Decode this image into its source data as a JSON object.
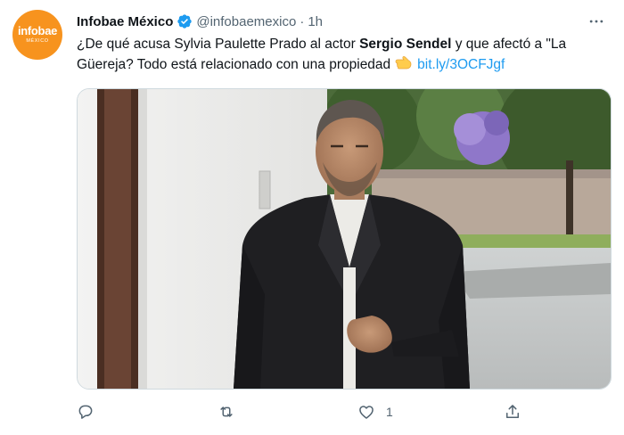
{
  "tweet": {
    "author": {
      "display_name": "Infobae México",
      "handle": "@infobaemexico",
      "avatar_brand": "infobae",
      "avatar_sub": "MÉXICO",
      "verified": true
    },
    "separator": "·",
    "time": "1h",
    "more_label": "•••",
    "text": {
      "part1": "¿De qué acusa Sylvia Paulette Prado al actor ",
      "bold1": "Sergio Sendel",
      "part2": " y que afectó a \"La Güereja? Todo está relacionado con una propiedad",
      "link": "bit.ly/3OCFJgf"
    },
    "media": {
      "description_icon": "photo"
    },
    "actions": {
      "reply": {
        "icon": "reply-icon",
        "count": ""
      },
      "retweet": {
        "icon": "retweet-icon",
        "count": ""
      },
      "like": {
        "icon": "like-icon",
        "count": "1"
      },
      "share": {
        "icon": "share-icon",
        "count": ""
      }
    },
    "colors": {
      "brand_orange": "#f7931e",
      "verified_blue": "#1d9bf0",
      "link_blue": "#1d9bf0",
      "secondary_text": "#536471"
    }
  }
}
